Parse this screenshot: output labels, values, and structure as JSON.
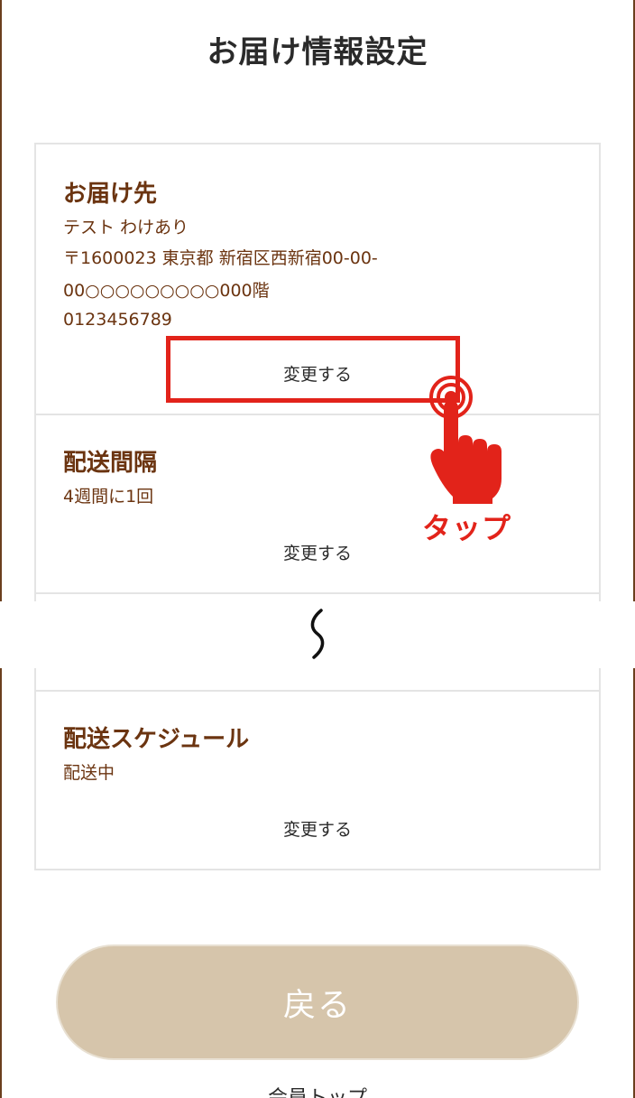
{
  "page": {
    "title": "お届け情報設定",
    "below_text": "会員トップ"
  },
  "sections": {
    "delivery_address": {
      "title": "お届け先",
      "name": "テスト わけあり",
      "address_line1": "〒1600023 東京都 新宿区西新宿00-00-",
      "address_line2": "00○○○○○○○○○000階",
      "phone": "0123456789",
      "change_label": "変更する"
    },
    "delivery_interval": {
      "title": "配送間隔",
      "value": "4週間に1回",
      "change_label": "変更する"
    },
    "delivery_schedule": {
      "title": "配送スケジュール",
      "value": "配送中",
      "change_label": "変更する"
    }
  },
  "annotation": {
    "tap_label": "タップ",
    "icon": "tap-hand-icon",
    "color": "#e2231a"
  },
  "back_button": {
    "label": "戻る"
  },
  "colors": {
    "accent_text": "#6b3410",
    "button_bg": "#d6c5ab",
    "frame": "#6b3f1e"
  }
}
